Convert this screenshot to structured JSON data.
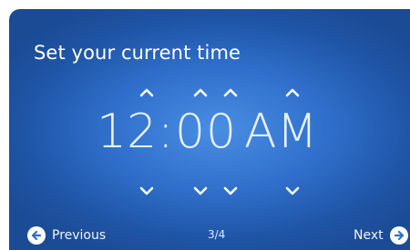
{
  "screen": {
    "title": "Set your current time",
    "time": {
      "hour": "12",
      "separator": ":",
      "minute_tens": "0",
      "minute_ones": "0",
      "meridiem": "AM"
    },
    "page_indicator": "3/4"
  },
  "nav": {
    "previous_label": "Previous",
    "next_label": "Next"
  },
  "icons": {
    "up": "chevron-up-icon",
    "down": "chevron-down-icon",
    "previous": "arrow-left-icon",
    "next": "arrow-right-icon"
  },
  "colors": {
    "background_center": "#4a8ee3",
    "background_edge": "#1b4b95",
    "text": "#ffffff",
    "nav_arrow": "#2f6fcb"
  }
}
